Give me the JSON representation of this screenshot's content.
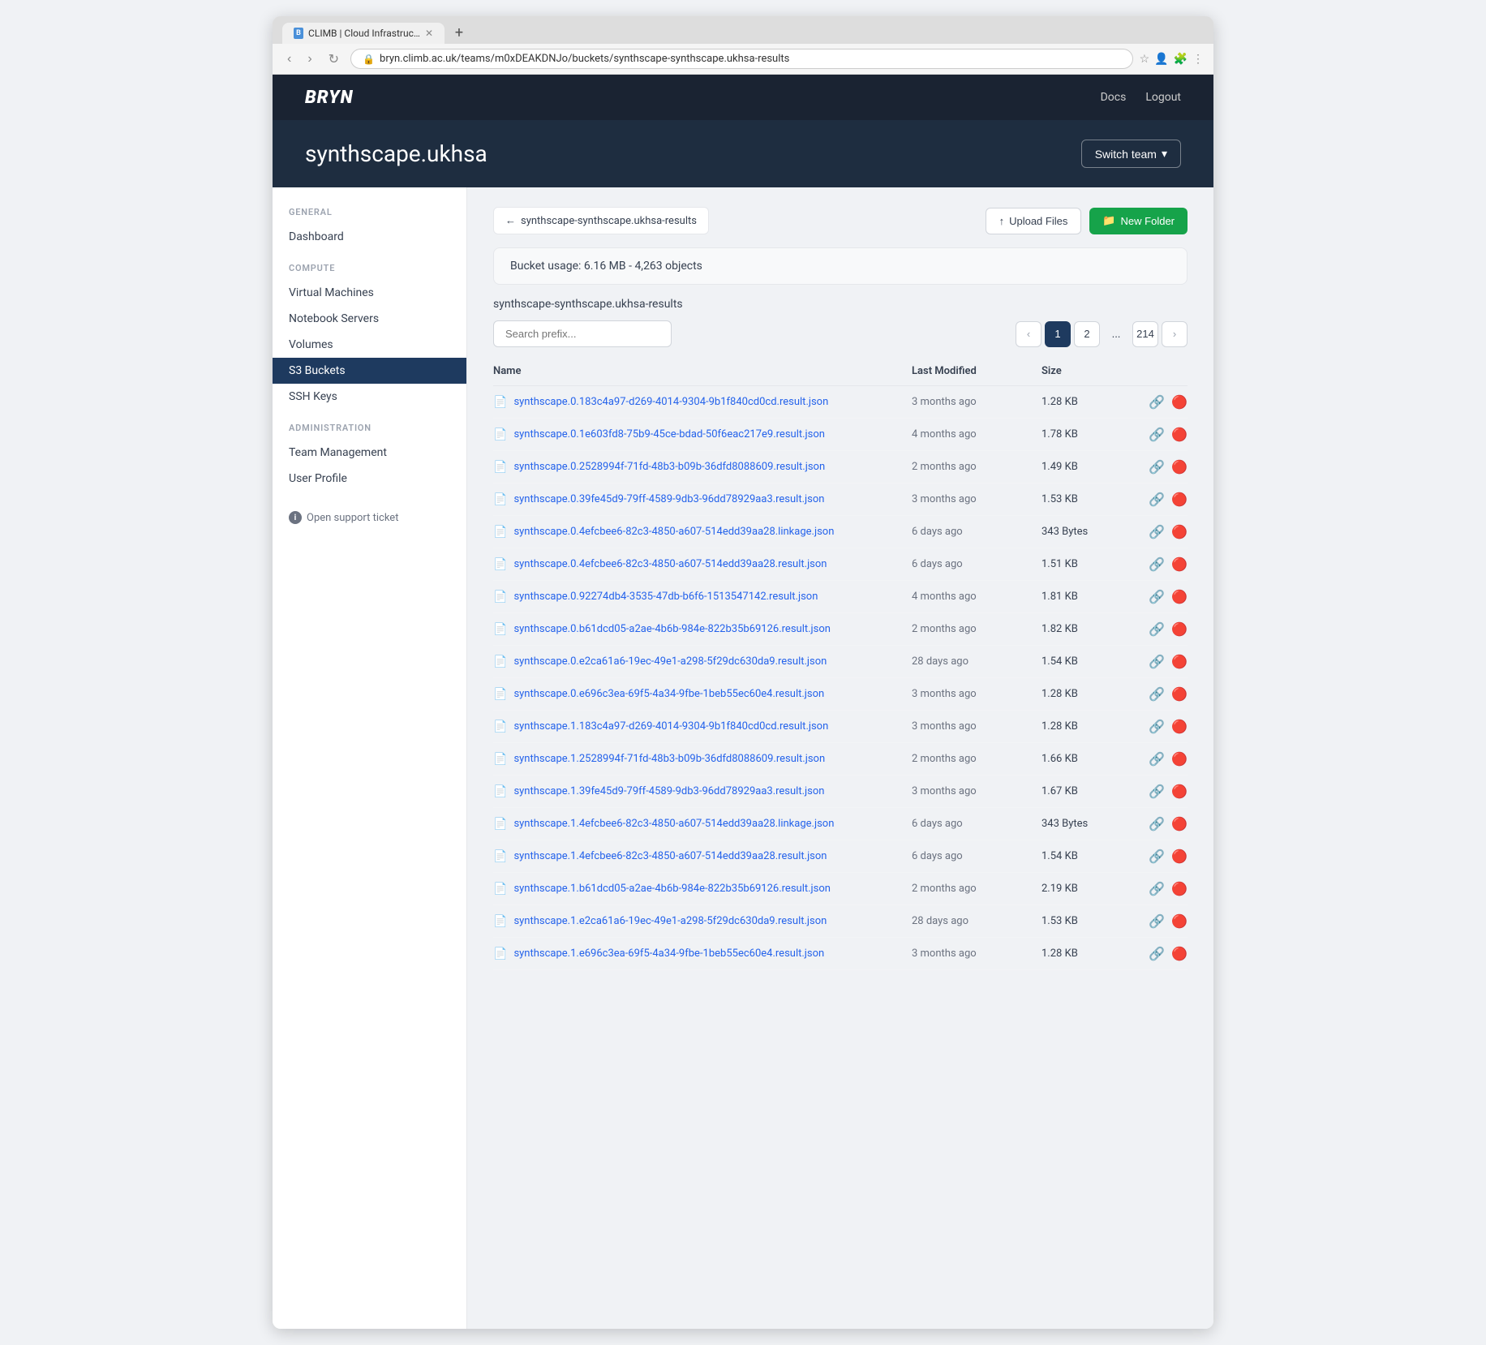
{
  "browser": {
    "url": "bryn.climb.ac.uk/teams/m0xDEAKDNJo/buckets/synthscape-synthscape.ukhsa-results",
    "tab_title": "CLIMB | Cloud Infrastructure...",
    "tab_favicon": "B"
  },
  "nav": {
    "logo": "BRYN",
    "links": [
      {
        "label": "Docs",
        "key": "docs"
      },
      {
        "label": "Logout",
        "key": "logout"
      }
    ]
  },
  "header": {
    "title": "synthscape.ukhsa",
    "switch_team_label": "Switch team"
  },
  "sidebar": {
    "general_label": "GENERAL",
    "compute_label": "COMPUTE",
    "administration_label": "ADMINISTRATION",
    "items_general": [
      {
        "label": "Dashboard",
        "key": "dashboard",
        "active": false
      }
    ],
    "items_compute": [
      {
        "label": "Virtual Machines",
        "key": "virtual-machines",
        "active": false
      },
      {
        "label": "Notebook Servers",
        "key": "notebook-servers",
        "active": false
      },
      {
        "label": "Volumes",
        "key": "volumes",
        "active": false
      },
      {
        "label": "S3 Buckets",
        "key": "s3-buckets",
        "active": true
      },
      {
        "label": "SSH Keys",
        "key": "ssh-keys",
        "active": false
      }
    ],
    "items_administration": [
      {
        "label": "Team Management",
        "key": "team-management",
        "active": false
      },
      {
        "label": "User Profile",
        "key": "user-profile",
        "active": false
      }
    ],
    "support_link": "Open support ticket"
  },
  "breadcrumb": {
    "back_label": "synthscape-synthscape.ukhsa-results",
    "upload_label": "Upload Files",
    "new_folder_label": "New Folder"
  },
  "bucket": {
    "usage_text": "Bucket usage: 6.16 MB - 4,263 objects",
    "path": "synthscape-synthscape.ukhsa-results",
    "search_placeholder": "Search prefix..."
  },
  "pagination": {
    "prev": "‹",
    "next": "›",
    "pages": [
      "1",
      "2",
      "...",
      "214"
    ],
    "current": "1"
  },
  "table": {
    "headers": {
      "name": "Name",
      "last_modified": "Last Modified",
      "size": "Size"
    },
    "files": [
      {
        "name": "synthscape.0.183c4a97-d269-4014-9304-9b1f840cd0cd.result.json",
        "modified": "3 months ago",
        "size": "1.28 KB"
      },
      {
        "name": "synthscape.0.1e603fd8-75b9-45ce-bdad-50f6eac217e9.result.json",
        "modified": "4 months ago",
        "size": "1.78 KB"
      },
      {
        "name": "synthscape.0.2528994f-71fd-48b3-b09b-36dfd8088609.result.json",
        "modified": "2 months ago",
        "size": "1.49 KB"
      },
      {
        "name": "synthscape.0.39fe45d9-79ff-4589-9db3-96dd78929aa3.result.json",
        "modified": "3 months ago",
        "size": "1.53 KB"
      },
      {
        "name": "synthscape.0.4efcbee6-82c3-4850-a607-514edd39aa28.linkage.json",
        "modified": "6 days ago",
        "size": "343 Bytes"
      },
      {
        "name": "synthscape.0.4efcbee6-82c3-4850-a607-514edd39aa28.result.json",
        "modified": "6 days ago",
        "size": "1.51 KB"
      },
      {
        "name": "synthscape.0.92274db4-3535-47db-b6f6-1513547142.result.json",
        "modified": "4 months ago",
        "size": "1.81 KB"
      },
      {
        "name": "synthscape.0.b61dcd05-a2ae-4b6b-984e-822b35b69126.result.json",
        "modified": "2 months ago",
        "size": "1.82 KB"
      },
      {
        "name": "synthscape.0.e2ca61a6-19ec-49e1-a298-5f29dc630da9.result.json",
        "modified": "28 days ago",
        "size": "1.54 KB"
      },
      {
        "name": "synthscape.0.e696c3ea-69f5-4a34-9fbe-1beb55ec60e4.result.json",
        "modified": "3 months ago",
        "size": "1.28 KB"
      },
      {
        "name": "synthscape.1.183c4a97-d269-4014-9304-9b1f840cd0cd.result.json",
        "modified": "3 months ago",
        "size": "1.28 KB"
      },
      {
        "name": "synthscape.1.2528994f-71fd-48b3-b09b-36dfd8088609.result.json",
        "modified": "2 months ago",
        "size": "1.66 KB"
      },
      {
        "name": "synthscape.1.39fe45d9-79ff-4589-9db3-96dd78929aa3.result.json",
        "modified": "3 months ago",
        "size": "1.67 KB"
      },
      {
        "name": "synthscape.1.4efcbee6-82c3-4850-a607-514edd39aa28.linkage.json",
        "modified": "6 days ago",
        "size": "343 Bytes"
      },
      {
        "name": "synthscape.1.4efcbee6-82c3-4850-a607-514edd39aa28.result.json",
        "modified": "6 days ago",
        "size": "1.54 KB"
      },
      {
        "name": "synthscape.1.b61dcd05-a2ae-4b6b-984e-822b35b69126.result.json",
        "modified": "2 months ago",
        "size": "2.19 KB"
      },
      {
        "name": "synthscape.1.e2ca61a6-19ec-49e1-a298-5f29dc630da9.result.json",
        "modified": "28 days ago",
        "size": "1.53 KB"
      },
      {
        "name": "synthscape.1.e696c3ea-69f5-4a34-9fbe-1beb55ec60e4.result.json",
        "modified": "3 months ago",
        "size": "1.28 KB"
      }
    ]
  }
}
